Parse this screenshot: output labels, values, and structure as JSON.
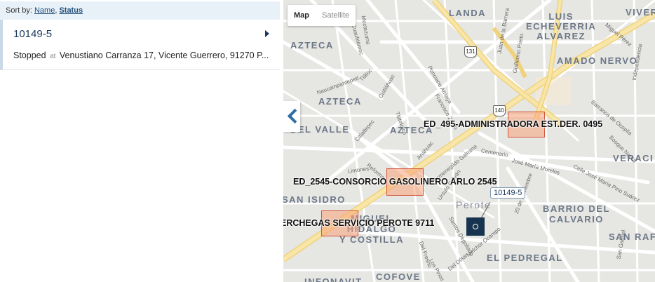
{
  "sort": {
    "label": "Sort by:",
    "name": "Name",
    "sep": ",",
    "status": "Status"
  },
  "vehicle": {
    "id": "10149-5",
    "status": "Stopped",
    "at": "at",
    "address": "Venustiano Carranza 17, Vicente Guerrero, 91270 P..."
  },
  "map": {
    "map_label": "Map",
    "satellite_label": "Satellite",
    "geofences": [
      "ED_495-ADMINISTRADORA EST.DER. 0495",
      "ED_2545-CONSORCIO GASOLINERO ARLO 2545",
      "ERCHEGAS SERVICIO PEROTE 9711"
    ],
    "vehicle_callout": "10149-5",
    "places": {
      "landa": "LANDA",
      "viver": "VIVER",
      "luis_echeverria": "LUIS\nECHEVERRIA\nALVAREZ",
      "azteca1": "AZTECA",
      "amado_nervo": "AMADO NERVO",
      "azteca2": "AZTECA",
      "del_valle": "DEL VALLE",
      "azteca3": "AZTECA",
      "veraci": "VERACI",
      "san_isidro": "SAN ISIDRO",
      "miguel_hidalgo": "MIGUEL\nHIDALGO\nY COSTILLA",
      "perote": "Perote",
      "barrio_calvario": "BARRIO DEL\nCALVARIO",
      "san_raf": "SAN RAF",
      "el_pedregal": "EL PEDREGAL",
      "cofove": "COFOVE",
      "bottom": "INFONAVIT"
    },
    "streets": {
      "s1": "Moctezuma",
      "s2": "Cuauhtémoc",
      "s3": "Naucampantepetl",
      "s4": "Tláloc",
      "s5": "Cuitláhuac",
      "s6": "Ponciano Arriaga",
      "s7": "Francisco Zarco",
      "s8": "Juan de la Barrera",
      "s9": "Guillermo Prieto",
      "s10": "Reforma",
      "s11": "Citlaltepec",
      "s12": "Tlatelolco",
      "s13": "Anáhuac",
      "s14": "Centenario",
      "s15": "José María Morelos",
      "s16": "Calle José María Pino Suárez",
      "s17": "Hermenegildo Galeana",
      "s18": "Limones",
      "s19": "Ursulo Galván",
      "s20": "Santos Degollado",
      "s21": "20 de Noviembre",
      "s22": "Del Fresno",
      "s23": "Melchor Ocampo",
      "s24": "Los Pinos",
      "s25": "Del Dólar",
      "s26": "Barranca de Ocopila",
      "s27": "Bosque Nauta",
      "s28": "San Gabriel",
      "s29": "Miguel Pérez",
      "s30": "Independencia"
    },
    "shields": {
      "a": "131",
      "b": "140"
    }
  }
}
